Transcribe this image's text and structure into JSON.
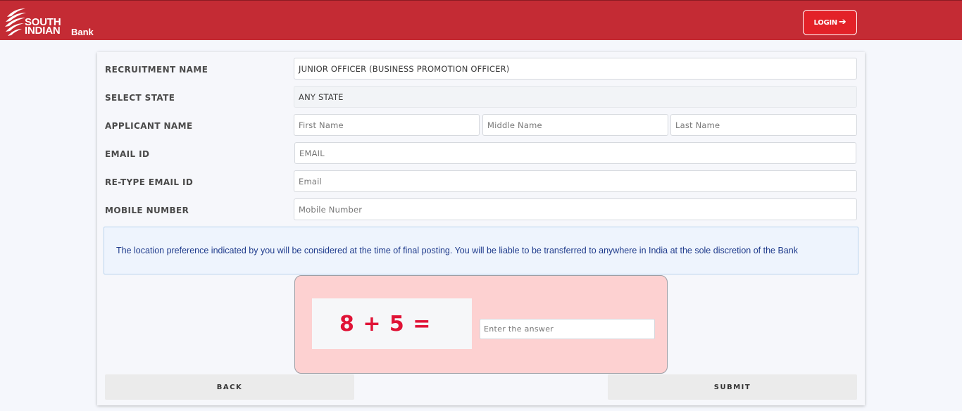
{
  "header": {
    "logo_line1": "SOUTH",
    "logo_line2": "INDIAN",
    "logo_line3": "Bank",
    "login_label": "LOGIN",
    "login_arrow": "➔",
    "bg_color": "#c42b34",
    "login_color": "#e32128"
  },
  "form": {
    "recruitment_label": "RECRUITMENT NAME",
    "recruitment_value": "JUNIOR OFFICER (BUSINESS PROMOTION OFFICER)",
    "state_label": "SELECT STATE",
    "state_value": "ANY STATE",
    "applicant_label": "APPLICANT NAME",
    "first_name_placeholder": "First Name",
    "middle_name_placeholder": "Middle Name",
    "last_name_placeholder": "Last Name",
    "email_label": "EMAIL ID",
    "email_placeholder": "EMAIL",
    "retype_email_label": "RE-TYPE EMAIL ID",
    "retype_email_placeholder": "Email",
    "mobile_label": "MOBILE NUMBER",
    "mobile_placeholder": "Mobile Number"
  },
  "notice": "The location preference indicated by you will be considered at the time of final posting. You will be liable to be transferred to anywhere in India at the sole discretion of the Bank",
  "captcha": {
    "question": "8 + 5 =",
    "answer_placeholder": "Enter the answer",
    "question_color": "#e01336"
  },
  "actions": {
    "back_label": "BACK",
    "submit_label": "SUBMIT"
  }
}
